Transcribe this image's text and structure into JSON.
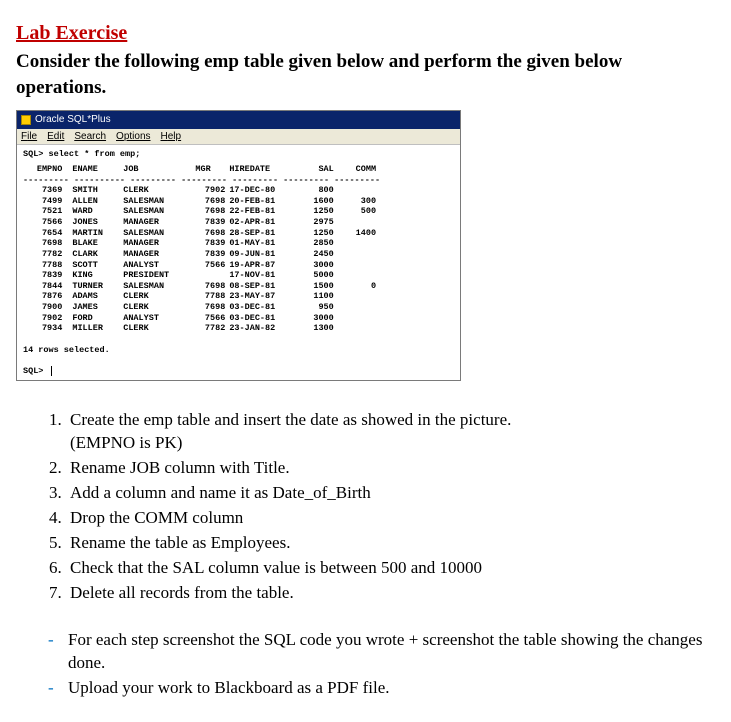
{
  "heading": "Lab Exercise",
  "intro": "Consider the following emp table given below and perform the given below operations.",
  "window": {
    "title": "Oracle SQL*Plus",
    "menu": [
      "File",
      "Edit",
      "Search",
      "Options",
      "Help"
    ],
    "query": "SQL> select * from emp;",
    "status": "14 rows selected.",
    "prompt": "SQL>",
    "columns": [
      "EMPNO",
      "ENAME",
      "JOB",
      "MGR",
      "HIREDATE",
      "SAL",
      "COMM"
    ],
    "rows": [
      {
        "empno": "7369",
        "ename": "SMITH",
        "job": "CLERK",
        "mgr": "7902",
        "hiredate": "17-DEC-80",
        "sal": "800",
        "comm": ""
      },
      {
        "empno": "7499",
        "ename": "ALLEN",
        "job": "SALESMAN",
        "mgr": "7698",
        "hiredate": "20-FEB-81",
        "sal": "1600",
        "comm": "300"
      },
      {
        "empno": "7521",
        "ename": "WARD",
        "job": "SALESMAN",
        "mgr": "7698",
        "hiredate": "22-FEB-81",
        "sal": "1250",
        "comm": "500"
      },
      {
        "empno": "7566",
        "ename": "JONES",
        "job": "MANAGER",
        "mgr": "7839",
        "hiredate": "02-APR-81",
        "sal": "2975",
        "comm": ""
      },
      {
        "empno": "7654",
        "ename": "MARTIN",
        "job": "SALESMAN",
        "mgr": "7698",
        "hiredate": "28-SEP-81",
        "sal": "1250",
        "comm": "1400"
      },
      {
        "empno": "7698",
        "ename": "BLAKE",
        "job": "MANAGER",
        "mgr": "7839",
        "hiredate": "01-MAY-81",
        "sal": "2850",
        "comm": ""
      },
      {
        "empno": "7782",
        "ename": "CLARK",
        "job": "MANAGER",
        "mgr": "7839",
        "hiredate": "09-JUN-81",
        "sal": "2450",
        "comm": ""
      },
      {
        "empno": "7788",
        "ename": "SCOTT",
        "job": "ANALYST",
        "mgr": "7566",
        "hiredate": "19-APR-87",
        "sal": "3000",
        "comm": ""
      },
      {
        "empno": "7839",
        "ename": "KING",
        "job": "PRESIDENT",
        "mgr": "",
        "hiredate": "17-NOV-81",
        "sal": "5000",
        "comm": ""
      },
      {
        "empno": "7844",
        "ename": "TURNER",
        "job": "SALESMAN",
        "mgr": "7698",
        "hiredate": "08-SEP-81",
        "sal": "1500",
        "comm": "0"
      },
      {
        "empno": "7876",
        "ename": "ADAMS",
        "job": "CLERK",
        "mgr": "7788",
        "hiredate": "23-MAY-87",
        "sal": "1100",
        "comm": ""
      },
      {
        "empno": "7900",
        "ename": "JAMES",
        "job": "CLERK",
        "mgr": "7698",
        "hiredate": "03-DEC-81",
        "sal": "950",
        "comm": ""
      },
      {
        "empno": "7902",
        "ename": "FORD",
        "job": "ANALYST",
        "mgr": "7566",
        "hiredate": "03-DEC-81",
        "sal": "3000",
        "comm": ""
      },
      {
        "empno": "7934",
        "ename": "MILLER",
        "job": "CLERK",
        "mgr": "7782",
        "hiredate": "23-JAN-82",
        "sal": "1300",
        "comm": ""
      }
    ]
  },
  "tasks": [
    "Create the emp table and insert the date as showed in the picture. (EMPNO is PK)",
    "Rename JOB column with Title.",
    "Add a column and name it as Date_of_Birth",
    "Drop the COMM column",
    "Rename the table as Employees.",
    "Check that the SAL column value is between 500 and 10000",
    "Delete all records from the table."
  ],
  "task1_sub": "(EMPNO is PK)",
  "task1_main": "Create the emp table and insert the date as showed in the picture.",
  "notes": [
    "For each step screenshot the SQL code you wrote + screenshot the table showing the changes done.",
    "Upload your work to Blackboard as a PDF file."
  ]
}
